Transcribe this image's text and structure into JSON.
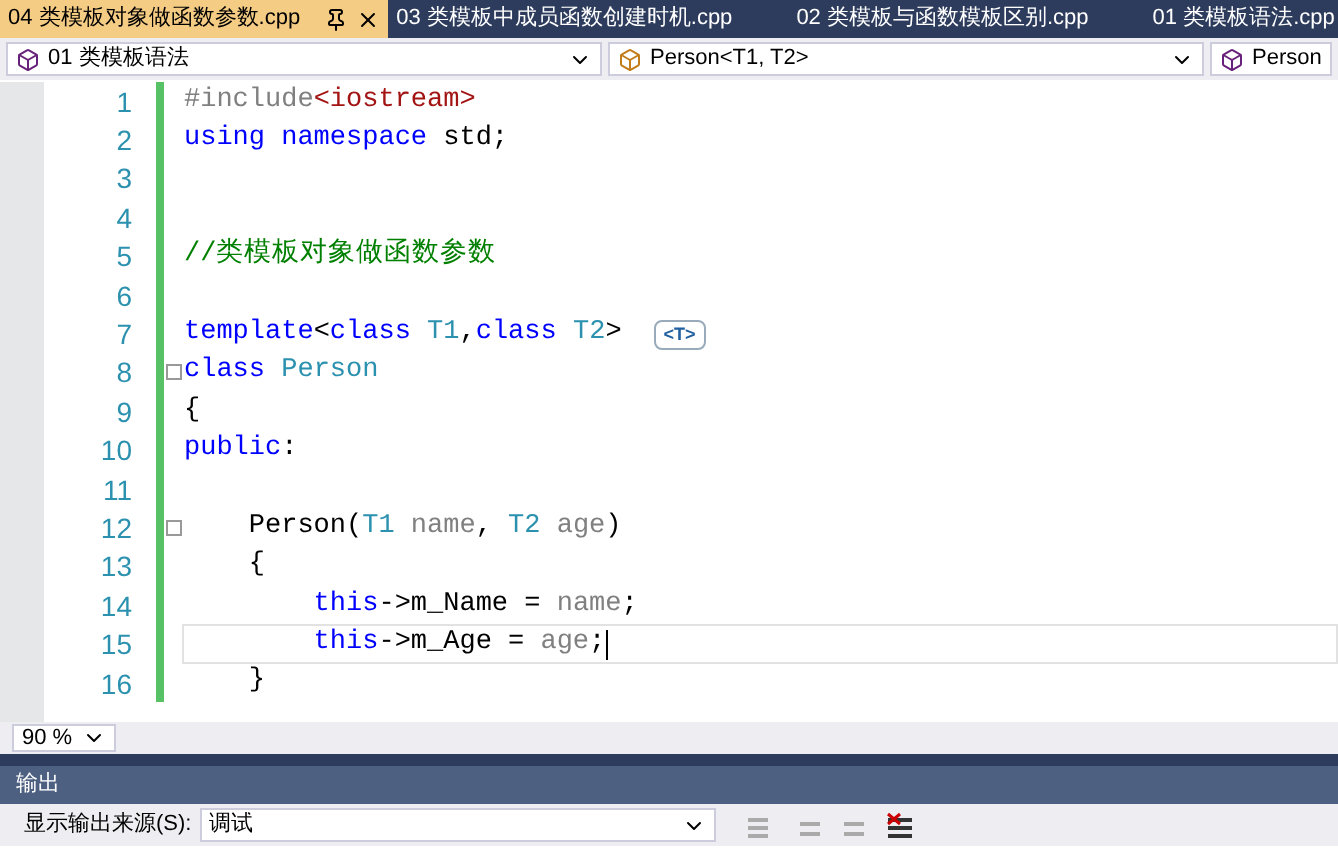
{
  "tabs": [
    {
      "label": "04 类模板对象做函数参数.cpp",
      "selected": true
    },
    {
      "label": "03 类模板中成员函数创建时机.cpp",
      "selected": false
    },
    {
      "label": "02 类模板与函数模板区别.cpp",
      "selected": false
    },
    {
      "label": "01 类模板语法.cpp",
      "selected": false
    }
  ],
  "nav": {
    "project": "01 类模板语法",
    "scope": "Person<T1, T2>",
    "member": "Person"
  },
  "lines": [
    {
      "number": "1",
      "foldable": false,
      "current": false,
      "tokens": [
        {
          "kind": "pre",
          "text": "#include"
        },
        {
          "kind": "str",
          "text": "<iostream>"
        }
      ]
    },
    {
      "number": "2",
      "foldable": false,
      "current": false,
      "tokens": [
        {
          "kind": "kw",
          "text": "using namespace"
        },
        {
          "kind": "plain",
          "text": " std;"
        }
      ]
    },
    {
      "number": "3",
      "foldable": false,
      "current": false
    },
    {
      "number": "4",
      "foldable": false,
      "current": false
    },
    {
      "number": "5",
      "foldable": false,
      "current": false,
      "tokens": [
        {
          "kind": "comment",
          "text": "//类模板对象做函数参数"
        }
      ]
    },
    {
      "number": "6",
      "foldable": false,
      "current": false
    },
    {
      "number": "7",
      "foldable": false,
      "current": false,
      "tokens": [
        {
          "kind": "kw",
          "text": "template"
        },
        {
          "kind": "plain",
          "text": "<"
        },
        {
          "kind": "kw",
          "text": "class"
        },
        {
          "kind": "type",
          "text": " T1"
        },
        {
          "kind": "plain",
          "text": ","
        },
        {
          "kind": "kw",
          "text": "class"
        },
        {
          "kind": "type",
          "text": " T2"
        },
        {
          "kind": "plain",
          "text": ">"
        },
        {
          "kind": "hint",
          "text": "<T>"
        }
      ]
    },
    {
      "number": "8",
      "foldable": true,
      "current": false,
      "tokens": [
        {
          "kind": "kw",
          "text": "class"
        },
        {
          "kind": "type",
          "text": " Person"
        }
      ]
    },
    {
      "number": "9",
      "foldable": false,
      "current": false,
      "tokens": [
        {
          "kind": "plain",
          "text": "{"
        }
      ]
    },
    {
      "number": "10",
      "foldable": false,
      "current": false,
      "tokens": [
        {
          "kind": "kw",
          "text": "public"
        },
        {
          "kind": "plain",
          "text": ":"
        }
      ]
    },
    {
      "number": "11",
      "foldable": false,
      "current": false
    },
    {
      "number": "12",
      "foldable": true,
      "current": false,
      "tokens": [
        {
          "kind": "plain",
          "text": "    Person("
        },
        {
          "kind": "type",
          "text": "T1"
        },
        {
          "kind": "param",
          "text": " name"
        },
        {
          "kind": "plain",
          "text": ", "
        },
        {
          "kind": "type",
          "text": "T2"
        },
        {
          "kind": "param",
          "text": " age"
        },
        {
          "kind": "plain",
          "text": ")"
        }
      ]
    },
    {
      "number": "13",
      "foldable": false,
      "current": false,
      "tokens": [
        {
          "kind": "plain",
          "text": "    {"
        }
      ]
    },
    {
      "number": "14",
      "foldable": false,
      "current": false,
      "tokens": [
        {
          "kind": "kw",
          "text": "        this"
        },
        {
          "kind": "plain",
          "text": "->m_Name = "
        },
        {
          "kind": "param",
          "text": "name"
        },
        {
          "kind": "plain",
          "text": ";"
        }
      ]
    },
    {
      "number": "15",
      "foldable": false,
      "current": true,
      "tokens": [
        {
          "kind": "kw",
          "text": "        this"
        },
        {
          "kind": "plain",
          "text": "->m_Age = "
        },
        {
          "kind": "param",
          "text": "age"
        },
        {
          "kind": "plain",
          "text": ";"
        }
      ]
    },
    {
      "number": "16",
      "foldable": false,
      "current": false,
      "tokens": [
        {
          "kind": "plain",
          "text": "    }"
        }
      ]
    }
  ],
  "zoom": "90 %",
  "output": {
    "title": "输出",
    "source_label": "显示输出来源(S):",
    "source": "调试"
  }
}
